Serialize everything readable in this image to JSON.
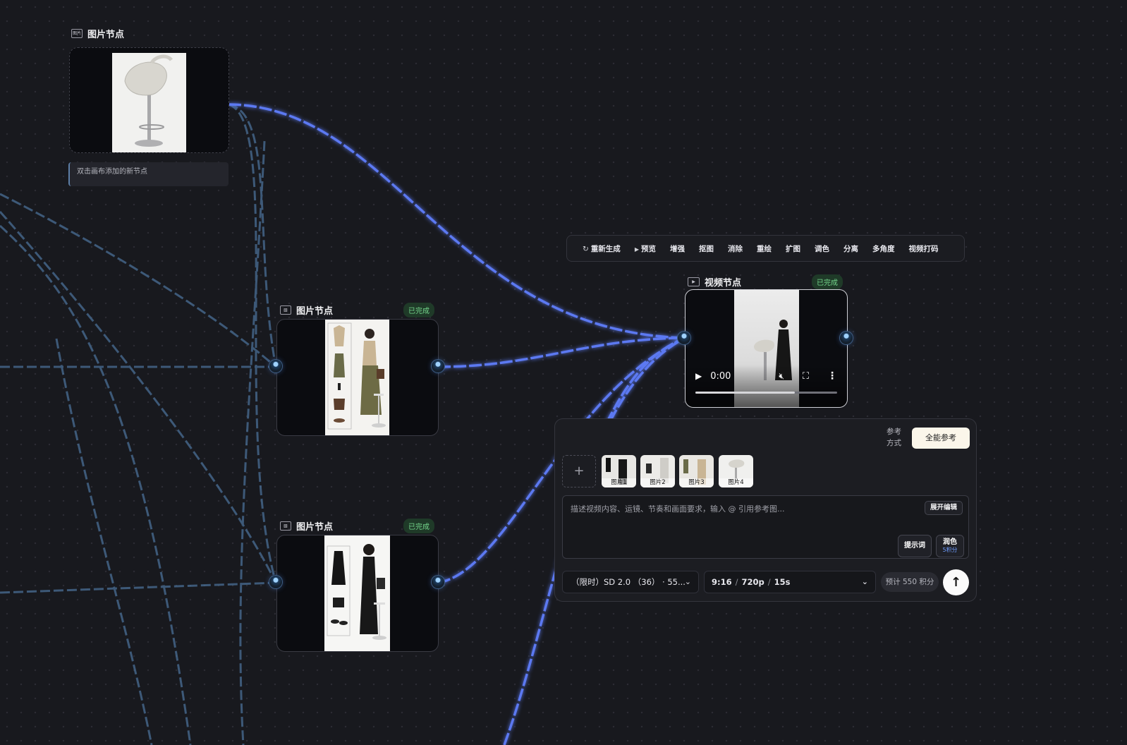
{
  "canvas": {
    "hint_text": "双击画布添加的新节点"
  },
  "nodes": [
    {
      "title": "图片节点",
      "icon": "image-node-icon",
      "icon_text": "图片",
      "status": ""
    },
    {
      "title": "图片节点",
      "icon": "image-node-icon",
      "status": "已完成"
    },
    {
      "title": "图片节点",
      "icon": "image-node-icon",
      "status": "已完成"
    },
    {
      "title": "视频节点",
      "icon": "video-node-icon",
      "status": "已完成"
    }
  ],
  "toolbar": {
    "items": [
      {
        "label": "重新生成",
        "icon": "refresh-icon",
        "glyph": "↻"
      },
      {
        "label": "预览",
        "icon": "play-icon",
        "glyph": "▶"
      },
      {
        "label": "增强"
      },
      {
        "label": "抠图"
      },
      {
        "label": "消除"
      },
      {
        "label": "重绘"
      },
      {
        "label": "扩图"
      },
      {
        "label": "调色"
      },
      {
        "label": "分离"
      },
      {
        "label": "多角度"
      },
      {
        "label": "视频打码"
      }
    ]
  },
  "video": {
    "time": "0:00",
    "progress": 0.7,
    "muted": true
  },
  "panel": {
    "ref_mode_label": "参考方式",
    "ref_mode_value": "全能参考",
    "add_icon_glyph": "+",
    "references": [
      "图片1",
      "图片2",
      "图片3",
      "图片4"
    ],
    "prompt_placeholder": "描述视频内容、运镜、节奏和画面要求，输入 @ 引用参考图...",
    "expand_label": "展开编辑",
    "hint_label": "提示词",
    "polish_label": "润色",
    "polish_cost": "5积分",
    "model_value": "（限时）SD 2.0 （36） · 55...",
    "spec_ratio": "9:16",
    "spec_res": "720p",
    "spec_duration": "15s",
    "spec_sep": "/",
    "cost_label": "预计 550 积分",
    "send_glyph": "↑"
  },
  "colors": {
    "background": "#18191e",
    "edge_active": "#5b79f2",
    "edge_idle": "#4a6f97",
    "status_green": "#74d68c",
    "ref_button": "#fbf6ea"
  }
}
